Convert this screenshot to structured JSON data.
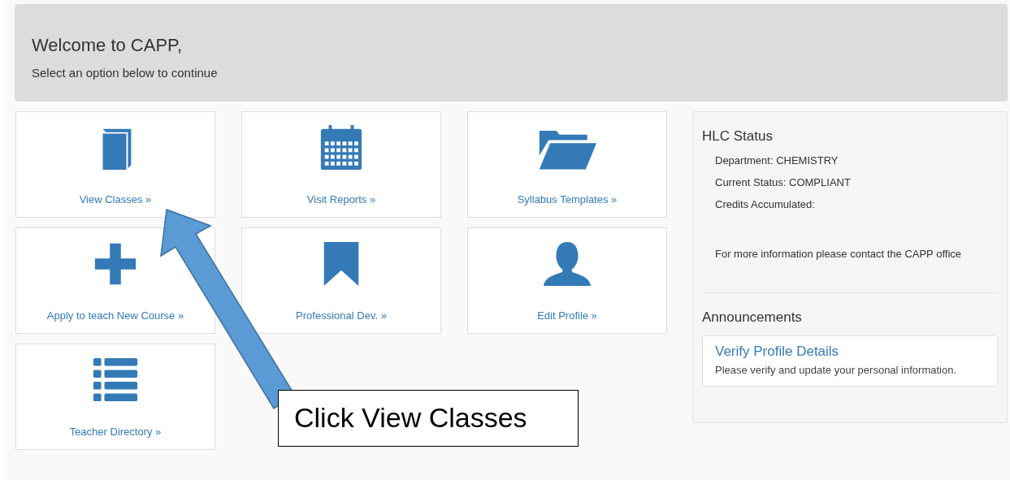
{
  "header": {
    "title": "Welcome to CAPP,",
    "subtitle": "Select an option below to continue"
  },
  "tiles": [
    {
      "label": "View Classes »",
      "kind": "book"
    },
    {
      "label": "Visit Reports »",
      "kind": "calendar"
    },
    {
      "label": "Syllabus Templates »",
      "kind": "folder"
    },
    {
      "label": "Apply to teach New Course »",
      "kind": "plus"
    },
    {
      "label": "Professional Dev. »",
      "kind": "bookmark"
    },
    {
      "label": "Edit Profile »",
      "kind": "person"
    },
    {
      "label": "Teacher Directory »",
      "kind": "list"
    }
  ],
  "status": {
    "title": "HLC Status",
    "lines": [
      "Department: CHEMISTRY",
      "Current Status: COMPLIANT",
      "Credits Accumulated:"
    ],
    "note": "For more information please contact the CAPP office"
  },
  "announcements": {
    "title": "Announcements",
    "items": [
      {
        "title": "Verify Profile Details",
        "text": "Please verify and update your personal information."
      }
    ]
  },
  "callout": {
    "text": "Click View Classes"
  }
}
